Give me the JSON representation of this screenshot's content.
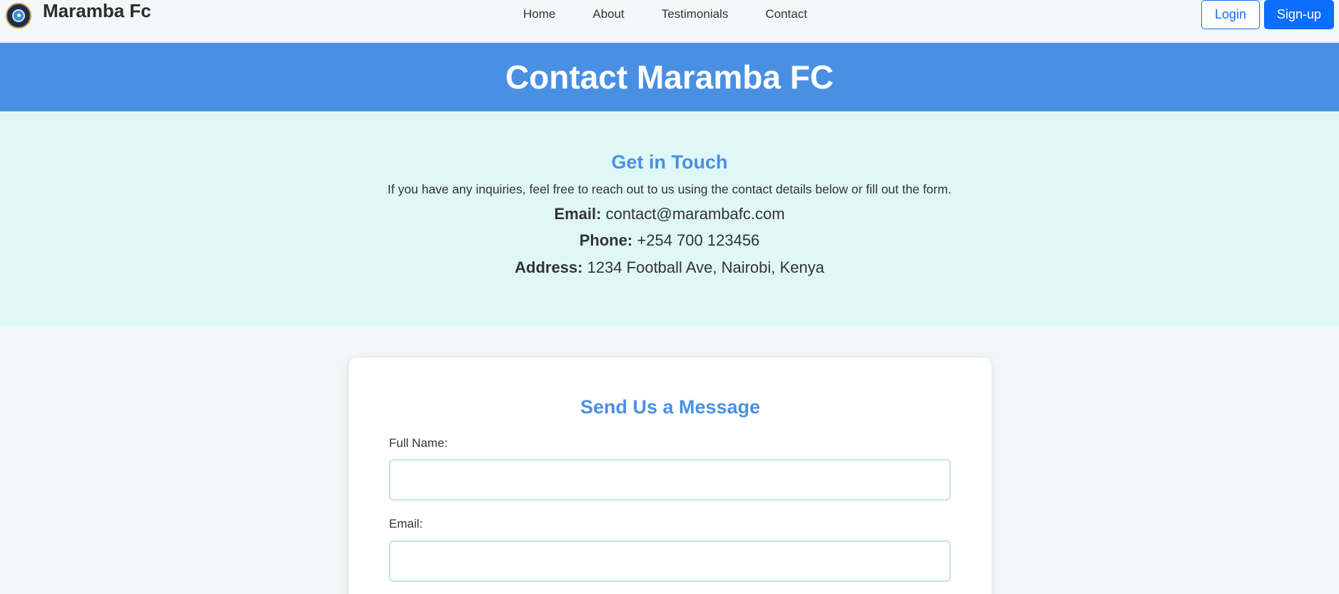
{
  "navbar": {
    "brand": "Maramba Fc",
    "links": [
      "Home",
      "About",
      "Testimonials",
      "Contact"
    ],
    "login_label": "Login",
    "signup_label": "Sign-up"
  },
  "hero": {
    "title": "Contact Maramba FC"
  },
  "contact": {
    "heading": "Get in Touch",
    "intro": "If you have any inquiries, feel free to reach out to us using the contact details below or fill out the form.",
    "email_label": "Email:",
    "email_value": "contact@marambafc.com",
    "phone_label": "Phone:",
    "phone_value": "+254 700 123456",
    "address_label": "Address:",
    "address_value": "1234 Football Ave, Nairobi, Kenya"
  },
  "form": {
    "heading": "Send Us a Message",
    "name_label": "Full Name:",
    "name_value": "",
    "email_label": "Email:",
    "email_value": ""
  },
  "colors": {
    "accent": "#4a90e2",
    "primary_button": "#0d6efd",
    "info_background": "#e0f7f8"
  }
}
